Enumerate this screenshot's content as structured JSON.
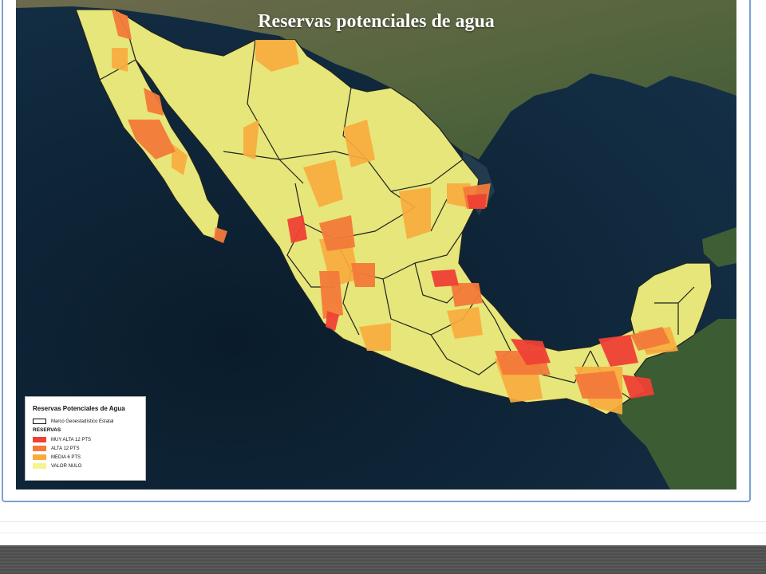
{
  "map": {
    "title": "Reservas potenciales de agua"
  },
  "legend": {
    "title": "Reservas Potenciales de Agua",
    "boundary_label": "Marco Geoestadístico Estatal",
    "heading": "RESERVAS",
    "items": [
      {
        "label": "MUY ALTA 12 PTS",
        "color": "#ef4135"
      },
      {
        "label": "ALTA 12 PTS",
        "color": "#f47a3a"
      },
      {
        "label": "MEDIA 6 PTS",
        "color": "#f9ac3e"
      },
      {
        "label": "VALOR NULO",
        "color": "#f7f48b"
      }
    ]
  },
  "colors": {
    "ocean": "#0d2234",
    "land_satellite": "#5c6b45",
    "territory": "#e6e67a",
    "state_border": "#222222"
  }
}
